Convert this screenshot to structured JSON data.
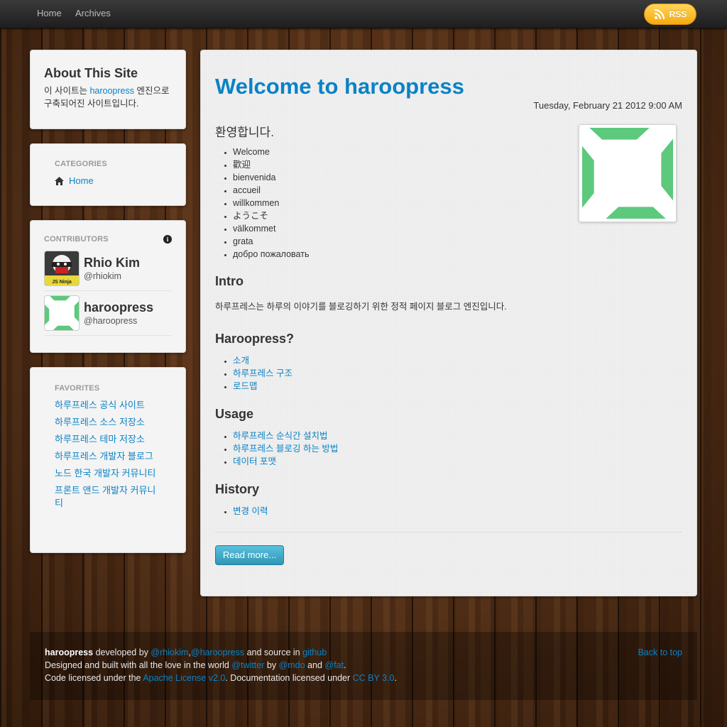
{
  "nav": {
    "links": [
      "Home",
      "Archives"
    ],
    "rss_label": "RSS"
  },
  "about": {
    "title": "About This Site",
    "text_before": "이 사이트는 ",
    "link": "haroopress",
    "text_after": " 엔진으로 구축되어진 사이트입니다."
  },
  "categories": {
    "header": "CATEGORIES",
    "items": [
      "Home"
    ]
  },
  "contributors": {
    "header": "CONTRIBUTORS",
    "people": [
      {
        "name": "Rhio Kim",
        "handle": "@rhiokim",
        "avatar_caption": "JS Ninja"
      },
      {
        "name": "haroopress",
        "handle": "@haroopress"
      }
    ]
  },
  "favorites": {
    "header": "FAVORITES",
    "items": [
      "하루프레스 공식 사이트",
      "하루프레스 소스 저장소",
      "하루프레스 테마 저장소",
      "하루프레스 개발자 블로그",
      "노드 한국 개발자 커뮤니티",
      "프론트 앤드 개발자 커뮤니티"
    ]
  },
  "post": {
    "title": "Welcome to haroopress",
    "date": "Tuesday, February 21 2012 9:00 AM",
    "greeting": "환영합니다.",
    "welcome_words": [
      "Welcome",
      "歡迎",
      "bienvenida",
      "accueil",
      "willkommen",
      "ようこそ",
      "välkommet",
      "grata",
      "добро пожаловать"
    ],
    "intro_heading": "Intro",
    "intro_text": "하루프레스는 하루의 이야기를 블로깅하기 위한 정적 페이지 블로그 엔진입니다.",
    "haroopress_heading": "Haroopress?",
    "haroopress_links": [
      "소개",
      "하루프레스 구조",
      "로드맵"
    ],
    "usage_heading": "Usage",
    "usage_links": [
      "하루프레스 순식간 설치법",
      "하루프레스 블로깅 하는 방법",
      "데이터 포맷"
    ],
    "history_heading": "History",
    "history_links": [
      "변경 이력"
    ],
    "read_more": "Read more..."
  },
  "footer": {
    "brand": "haroopress",
    "developed_by": " developed by ",
    "dev1": "@rhiokim",
    "comma": ",",
    "dev2": "@haroopress",
    "source_in": " and source in ",
    "github": "github",
    "period": ".",
    "line2_a": "Designed and built with all the love in the world ",
    "twitter": "@twitter",
    "by": " by ",
    "mdo": "@mdo",
    "and": " and ",
    "fat": "@fat",
    "line3_a": "Code licensed under the ",
    "apache": "Apache License v2.0",
    "line3_b": ". Documentation licensed under ",
    "ccby": "CC BY 3.0",
    "back_to_top": "Back to top"
  },
  "colors": {
    "link": "#0a82c6",
    "logo_green": "#5cc97c",
    "rss": "#f7b42c"
  },
  "icons": [
    "rss-icon",
    "home-icon",
    "info-icon"
  ]
}
